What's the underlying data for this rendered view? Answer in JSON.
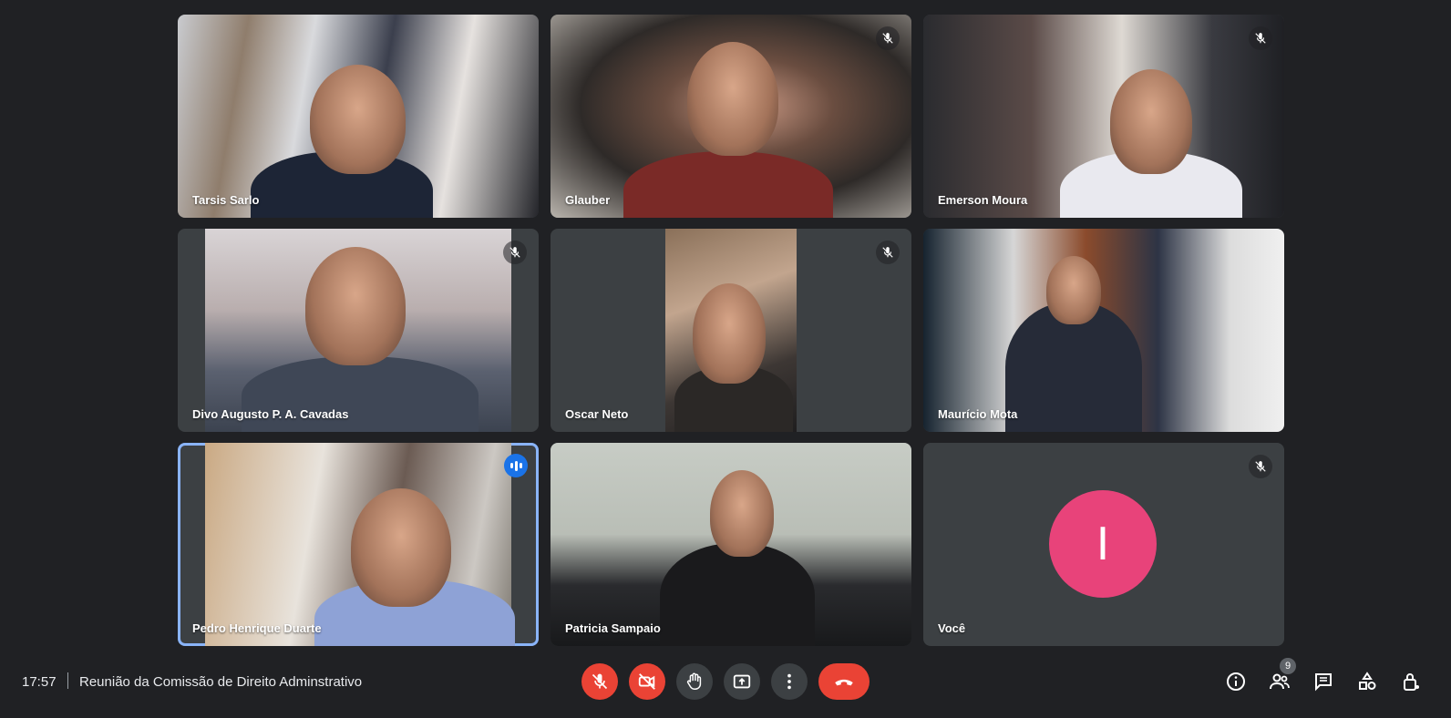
{
  "participants": [
    {
      "name": "Tarsis Sarlo",
      "muted": false,
      "speaking": false
    },
    {
      "name": "Glauber",
      "muted": true,
      "speaking": false
    },
    {
      "name": "Emerson Moura",
      "muted": true,
      "speaking": false
    },
    {
      "name": "Divo Augusto P. A. Cavadas",
      "muted": true,
      "speaking": false
    },
    {
      "name": "Oscar Neto",
      "muted": true,
      "speaking": false
    },
    {
      "name": "Maurício Mota",
      "muted": false,
      "speaking": false
    },
    {
      "name": "Pedro Henrique Duarte",
      "muted": false,
      "speaking": true
    },
    {
      "name": "Patricia Sampaio",
      "muted": false,
      "speaking": false
    },
    {
      "name": "Você",
      "muted": true,
      "speaking": false,
      "avatar_letter": "I",
      "avatar_color": "#e8437a"
    }
  ],
  "meeting": {
    "time": "17:57",
    "title": "Reunião da Comissão de Direito Adminstrativo"
  },
  "controls": {
    "mic": "mic-off-icon",
    "camera": "camera-off-icon",
    "hand": "raise-hand-icon",
    "present": "present-screen-icon",
    "more": "more-options-icon",
    "hangup": "hang-up-icon"
  },
  "toolbar": {
    "people_count": "9"
  },
  "colors": {
    "background": "#202124",
    "tile": "#3c4043",
    "danger": "#ea4335",
    "active_speaker": "#8ab4f8"
  }
}
